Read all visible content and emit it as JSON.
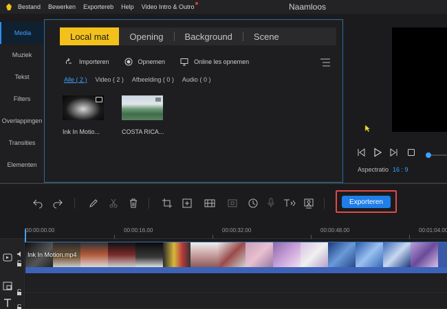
{
  "menubar": {
    "items": [
      "Bestand",
      "Bewerken",
      "Exportereb",
      "Help",
      "Video Intro & Outro"
    ],
    "window_title": "Naamloos"
  },
  "sidebar": {
    "items": [
      "Media",
      "Muziek",
      "Tekst",
      "Filters",
      "Overlappingen",
      "Transities",
      "Elementen"
    ]
  },
  "media": {
    "tabs": [
      "Local mat",
      "Opening",
      "Background",
      "Scene"
    ],
    "actions": [
      "Importeren",
      "Opnemen",
      "Online les opnemen"
    ],
    "filters": [
      "Alle ( 2 )",
      "Video ( 2 )",
      "Afbeelding ( 0 )",
      "Audio ( 0 )"
    ],
    "files": [
      "Ink In Motio...",
      "COSTA RICA..."
    ]
  },
  "preview": {
    "aspect_label": "Aspectratio",
    "aspect_value": "16 : 9"
  },
  "toolbar": {
    "export_label": "Exporteren"
  },
  "timeline": {
    "ticks": [
      "00:00:00.00",
      "00:00:16.00",
      "00:00:32.00",
      "00:00:48.00",
      "00:01:04.00"
    ],
    "clip_label": "Ink In Motion.mp4"
  },
  "colors": {
    "accent": "#3fa0ff",
    "tab_active": "#f3c11b",
    "export": "#1f7ee8",
    "highlight": "#e24a4a"
  }
}
